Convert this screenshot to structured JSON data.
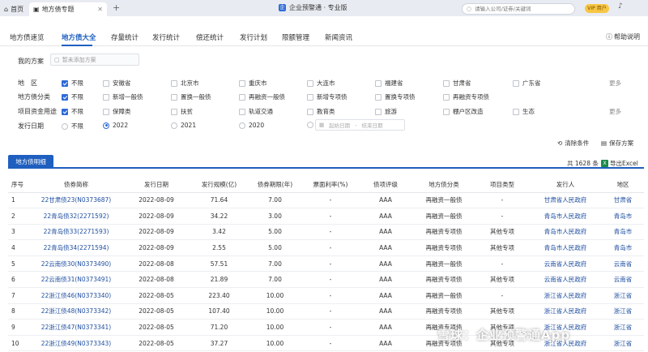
{
  "titlebar": {
    "home_tab": "首页",
    "active_tab": "地方债专题",
    "app_title": "企业预警通 · 专业版",
    "search_placeholder": "请输入公司/证券/关键词",
    "vip_label": "VIP 用户"
  },
  "nav": {
    "items": [
      "地方债速览",
      "地方债大全",
      "存量统计",
      "发行统计",
      "偿还统计",
      "发行计划",
      "限额管理",
      "新闻资讯"
    ],
    "help": "帮助说明"
  },
  "scheme": {
    "label": "我的方案",
    "placeholder": "暂未添加方案"
  },
  "filters": {
    "region": {
      "label": "地　区",
      "options": [
        "不限",
        "安徽省",
        "北京市",
        "重庆市",
        "大连市",
        "福建省",
        "甘肃省",
        "广东省"
      ],
      "more": "更多"
    },
    "category": {
      "label": "地方债分类",
      "options": [
        "不限",
        "新增一般债",
        "置换一般债",
        "再融资一般债",
        "新增专项债",
        "置换专项债",
        "再融资专项债"
      ]
    },
    "usage": {
      "label": "项目资金用途",
      "options": [
        "不限",
        "保障类",
        "扶贫",
        "轨道交通",
        "教育类",
        "旅游",
        "棚户区改造",
        "生态"
      ],
      "more": "更多"
    },
    "date": {
      "label": "发行日期",
      "options": [
        "不限",
        "2022",
        "2021",
        "2020"
      ],
      "start_placeholder": "起始日期",
      "end_placeholder": "结束日期"
    }
  },
  "actions": {
    "clear": "清除条件",
    "save": "保存方案"
  },
  "detail": {
    "tab": "地方债明细",
    "total": "共 1628 条",
    "export": "导出Excel"
  },
  "table": {
    "headers": [
      "序号",
      "债券简称",
      "发行日期",
      "发行规模(亿)",
      "债券期限(年)",
      "票面利率(%)",
      "债项评级",
      "地方债分类",
      "项目类型",
      "发行人",
      "地区"
    ],
    "rows": [
      [
        "1",
        "22甘肃债23(N0373687)",
        "2022-08-09",
        "71.64",
        "7.00",
        "-",
        "AAA",
        "再融资一般债",
        "-",
        "甘肃省人民政府",
        "甘肃省"
      ],
      [
        "2",
        "22青岛债32(2271592)",
        "2022-08-09",
        "34.22",
        "3.00",
        "-",
        "AAA",
        "再融资一般债",
        "-",
        "青岛市人民政府",
        "青岛市"
      ],
      [
        "3",
        "22青岛债33(2271593)",
        "2022-08-09",
        "3.42",
        "5.00",
        "-",
        "AAA",
        "再融资专项债",
        "其他专项",
        "青岛市人民政府",
        "青岛市"
      ],
      [
        "4",
        "22青岛债34(2271594)",
        "2022-08-09",
        "2.55",
        "5.00",
        "-",
        "AAA",
        "再融资专项债",
        "其他专项",
        "青岛市人民政府",
        "青岛市"
      ],
      [
        "5",
        "22云南债30(N0373490)",
        "2022-08-08",
        "57.51",
        "7.00",
        "-",
        "AAA",
        "再融资一般债",
        "-",
        "云南省人民政府",
        "云南省"
      ],
      [
        "6",
        "22云南债31(N0373491)",
        "2022-08-08",
        "21.89",
        "7.00",
        "-",
        "AAA",
        "再融资专项债",
        "其他专项",
        "云南省人民政府",
        "云南省"
      ],
      [
        "7",
        "22浙江债46(N0373340)",
        "2022-08-05",
        "223.40",
        "10.00",
        "-",
        "AAA",
        "再融资一般债",
        "-",
        "浙江省人民政府",
        "浙江省"
      ],
      [
        "8",
        "22浙江债48(N0373342)",
        "2022-08-05",
        "107.40",
        "10.00",
        "-",
        "AAA",
        "再融资专项债",
        "其他专项",
        "浙江省人民政府",
        "浙江省"
      ],
      [
        "9",
        "22浙江债47(N0373341)",
        "2022-08-05",
        "71.20",
        "10.00",
        "-",
        "AAA",
        "再融资专项债",
        "其他专项",
        "浙江省人民政府",
        "浙江省"
      ],
      [
        "10",
        "22浙江债49(N0373343)",
        "2022-08-05",
        "37.27",
        "10.00",
        "-",
        "AAA",
        "再融资专项债",
        "其他专项",
        "浙江省人民政府",
        "浙江省"
      ]
    ]
  },
  "watermark": "雪球：企业预警通App"
}
